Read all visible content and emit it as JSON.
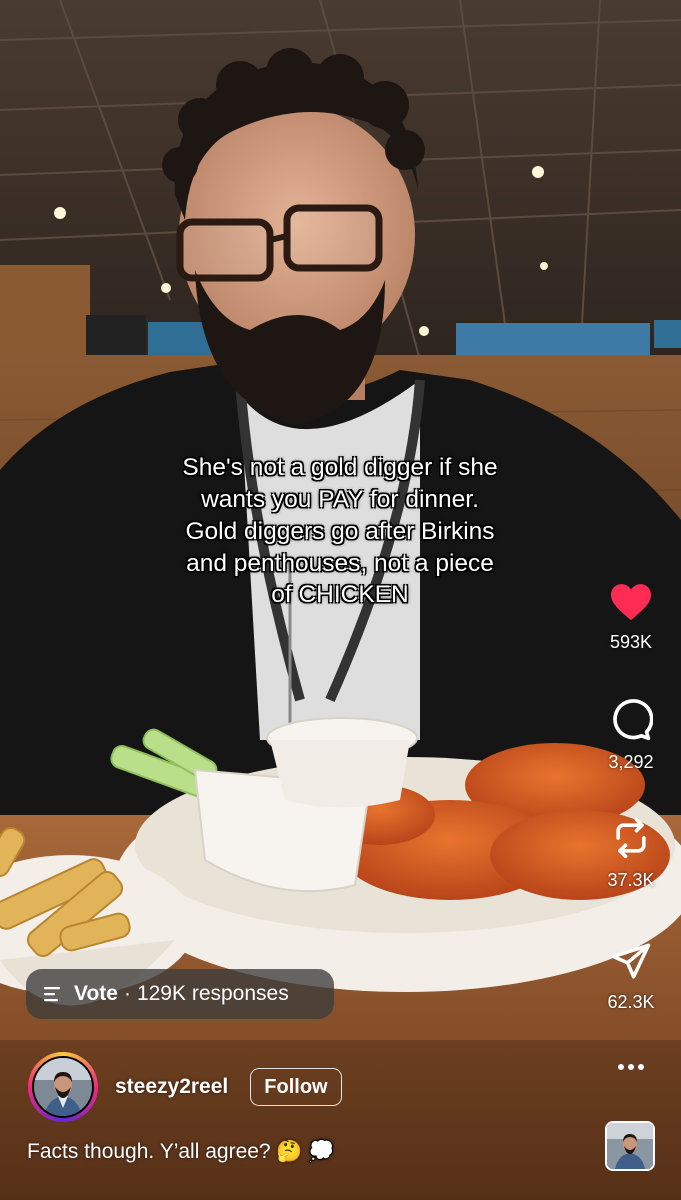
{
  "overlay": {
    "text": "She's not a gold digger if she\nwants you PAY for dinner.\nGold diggers go after Birkins\nand penthouses, not a piece\nof CHICKEN"
  },
  "actions": {
    "likes": "593K",
    "comments": "3,292",
    "reposts": "37.3K",
    "shares": "62.3K"
  },
  "poll": {
    "label": "Vote",
    "separator": "·",
    "responses": "129K responses"
  },
  "author": {
    "username": "steezy2reel",
    "follow_label": "Follow"
  },
  "caption": {
    "text": "Facts though. Y’all agree? 🤔 💭"
  },
  "colors": {
    "like_red": "#fe2c55",
    "pill_bg": "#3c3c3c",
    "accent_ring": "#ee2a7b"
  },
  "icons": [
    "heart-icon",
    "comment-icon",
    "repost-icon",
    "share-icon",
    "more-icon",
    "poll-icon"
  ]
}
